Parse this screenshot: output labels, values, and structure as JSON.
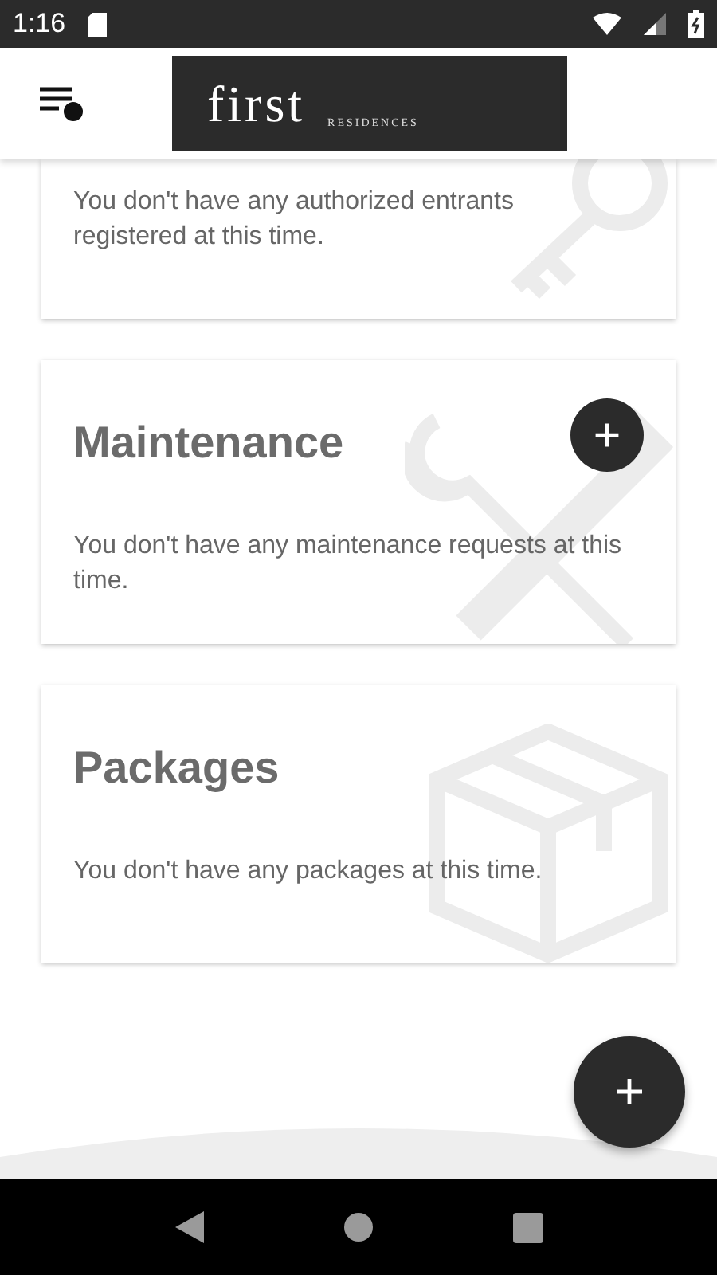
{
  "status_bar": {
    "time": "1:16"
  },
  "header": {
    "logo_main": "first",
    "logo_sub": "RESIDENCES"
  },
  "cards": [
    {
      "kind": "key",
      "body": "You don't have any authorized entrants registered at this time.",
      "add_button": false
    },
    {
      "kind": "wrench",
      "title": "Maintenance",
      "body": "You don't have any maintenance requests at this time.",
      "add_button": true
    },
    {
      "kind": "box",
      "title": "Packages",
      "body": "You don't have any packages at this time.",
      "add_button": false
    }
  ]
}
